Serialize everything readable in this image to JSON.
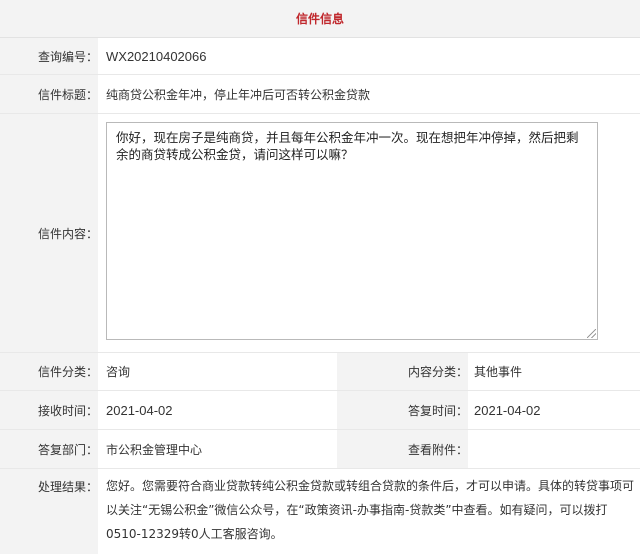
{
  "header": {
    "title": "信件信息"
  },
  "query_no": {
    "label": "查询编号：",
    "value": "WX20210402066"
  },
  "subject": {
    "label": "信件标题：",
    "value": "纯商贷公积金年冲，停止年冲后可否转公积金贷款"
  },
  "content": {
    "label": "信件内容：",
    "value": "你好，现在房子是纯商贷，并且每年公积金年冲一次。现在想把年冲停掉，然后把剩余的商贷转成公积金贷，请问这样可以嘛？"
  },
  "category": {
    "label": "信件分类：",
    "value": "咨询",
    "content_type_label": "内容分类：",
    "content_type_value": "其他事件"
  },
  "dates": {
    "received_label": "接收时间：",
    "received_value": "2021-04-02",
    "reply_label": "答复时间：",
    "reply_value": "2021-04-02"
  },
  "dept": {
    "label": "答复部门：",
    "value": "市公积金管理中心",
    "attachments_label": "查看附件："
  },
  "result": {
    "label": "处理结果：",
    "value": "您好。您需要符合商业贷款转纯公积金贷款或转组合贷款的条件后，才可以申请。具体的转贷事项可以关注“无锡公积金”微信公众号，在“政策资讯-办事指南-贷款类”中查看。如有疑问，可以拨打0510-12329转0人工客服咨询。"
  },
  "colors": {
    "accent": "#c0282d",
    "label_bg": "#f3f3f3"
  }
}
